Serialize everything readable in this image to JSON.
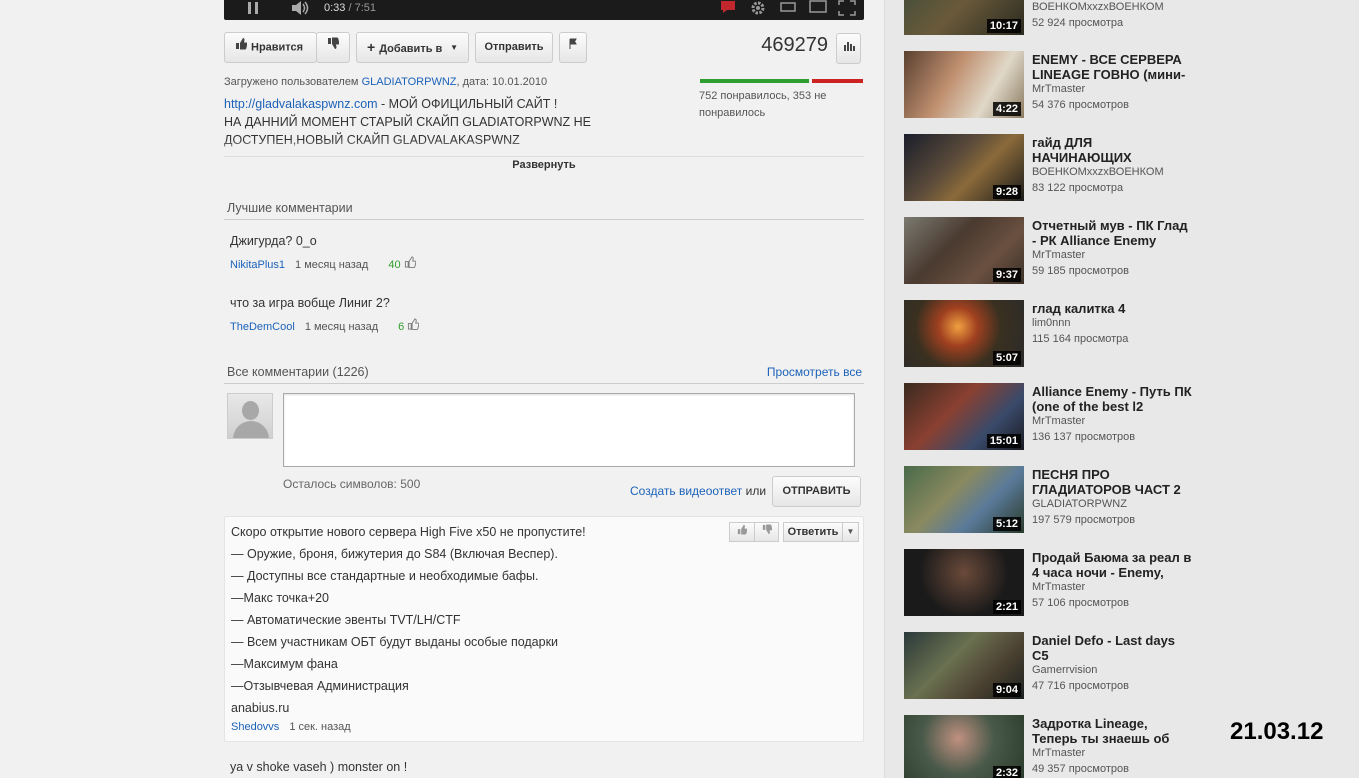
{
  "player": {
    "time_current": "0:33",
    "time_duration": " / 7:51"
  },
  "actions": {
    "like_label": "Нравится",
    "add_label": "Добавить в",
    "share_label": "Отправить",
    "view_count": "469279"
  },
  "upload": {
    "prefix": "Загружено пользователем",
    "user": "GLADIATORPWNZ",
    "date": ", дата: 10.01.2010"
  },
  "rating": {
    "like_fraction": 0.68,
    "text": "752 понравилось, 353 не понравилось",
    "colors": {
      "like": "#2e9e2e",
      "dislike": "#cc2222"
    }
  },
  "description": {
    "link": "http://gladvalakaspwnz.com",
    "line1_rest": " - МОЙ ОФИЦИЛЬНЫЙ САЙТ !",
    "line2": "НА ДАННИЙ МОМЕНТ СТАРЫЙ СКАЙП GLADIATORPWNZ НЕ ДОСТУПЕН,НОВЫЙ СКАЙП GLADVALAKASPWNZ",
    "expand_label": "Развернуть"
  },
  "top_comments": {
    "heading": "Лучшие комментарии",
    "items": [
      {
        "text": "Джигурда? 0_о",
        "user": "NikitaPlus1",
        "time": "1 месяц назад",
        "likes": "40"
      },
      {
        "text": "что за игра вобще Линиг 2?",
        "user": "TheDemCool",
        "time": "1 месяц назад",
        "likes": "6"
      }
    ]
  },
  "all_comments": {
    "heading": "Все комментарии (1226)",
    "view_all": "Просмотреть все",
    "chars_left": "Осталось символов: 500",
    "create_video": "Создать видеоответ",
    "or": " или",
    "send_label": "ОТПРАВИТЬ"
  },
  "spam_comment": {
    "reply_label": "Ответить",
    "lines": [
      "Скоро открытие нового сервера High Five x50 не пропустите!",
      "— Оружие, броня, бижутерия до S84 (Включая Веспер).",
      "— Доступны все стандартные и необходимые бафы.",
      "—Макс точка+20",
      "— Автоматические эвенты TVT/LH/CTF",
      "— Всем участникам ОБТ будут выданы особые подарки",
      "—Максимум фана",
      "—Отзывчевая Администрация",
      "anabius.ru"
    ],
    "user": "Shedovvs",
    "time": "1 сек. назад"
  },
  "last_comment": "ya v shoke vaseh ) monster on !",
  "sidebar": {
    "videos": [
      {
        "title": "",
        "author": "ВОЕНКОМxxzxВОЕНКОМ",
        "views": "52 924 просмотра",
        "duration": "10:17"
      },
      {
        "title": "ENEMY - ВСЕ СЕРВЕРА LINEAGE ГОВНО (мини-",
        "author": "MrTmaster",
        "views": "54 376 просмотров",
        "duration": "4:22"
      },
      {
        "title": "гайд ДЛЯ НАЧИНАЮЩИХ",
        "author": "ВОЕНКОМxxzxВОЕНКОМ",
        "views": "83 122 просмотра",
        "duration": "9:28"
      },
      {
        "title": "Отчетный мув - ПК Глад - РК Alliance Enemy",
        "author": "MrTmaster",
        "views": "59 185 просмотров",
        "duration": "9:37"
      },
      {
        "title": "глад калитка 4",
        "author": "lim0nnn",
        "views": "115 164 просмотра",
        "duration": "5:07"
      },
      {
        "title": "Alliance Enemy - Путь ПК (one of the best l2",
        "author": "MrTmaster",
        "views": "136 137 просмотров",
        "duration": "15:01"
      },
      {
        "title": "ПЕСНЯ ПРО ГЛАДИАТОРОВ ЧАСТ 2",
        "author": "GLADIATORPWNZ",
        "views": "197 579 просмотров",
        "duration": "5:12"
      },
      {
        "title": "Продай Баюма за реал в 4 часа ночи - Enemy,",
        "author": "MrTmaster",
        "views": "57 106 просмотров",
        "duration": "2:21"
      },
      {
        "title": "Daniel Defo - Last days C5",
        "author": "Gamerrvision",
        "views": "47 716 просмотров",
        "duration": "9:04"
      },
      {
        "title": "Задротка Lineage, Теперь ты знаешь об",
        "author": "MrTmaster",
        "views": "49 357 просмотров",
        "duration": "2:32"
      }
    ]
  },
  "date_stamp": "21.03.12"
}
